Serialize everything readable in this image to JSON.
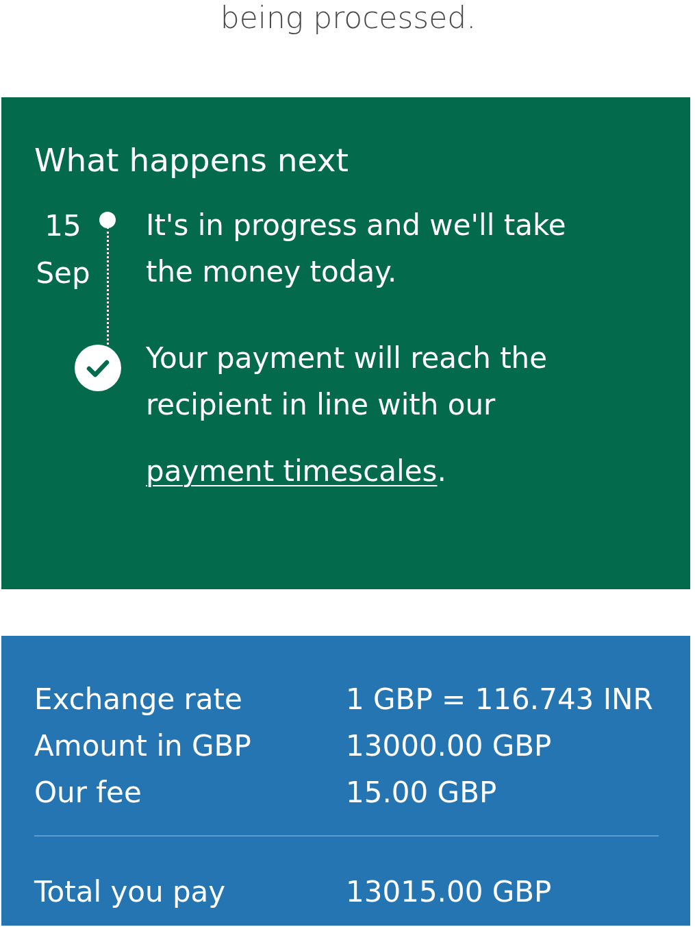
{
  "header": {
    "status_text": "being processed."
  },
  "next_steps": {
    "title": "What happens next",
    "steps": [
      {
        "kind": "current",
        "date": "15 Sep",
        "text": "It's in progress and we'll take the money today."
      },
      {
        "kind": "final",
        "text": "Your payment will reach the recipient in line with our",
        "link": "payment timescales",
        "suffix": "."
      }
    ]
  },
  "summary": {
    "rows": [
      {
        "label": "Exchange rate",
        "value": "1 GBP = 116.743 INR"
      },
      {
        "label": "Amount in GBP",
        "value": "13000.00 GBP"
      },
      {
        "label": "Our fee",
        "value": "15.00 GBP"
      }
    ],
    "total": {
      "label": "Total you pay",
      "value": "13015.00 GBP"
    }
  }
}
